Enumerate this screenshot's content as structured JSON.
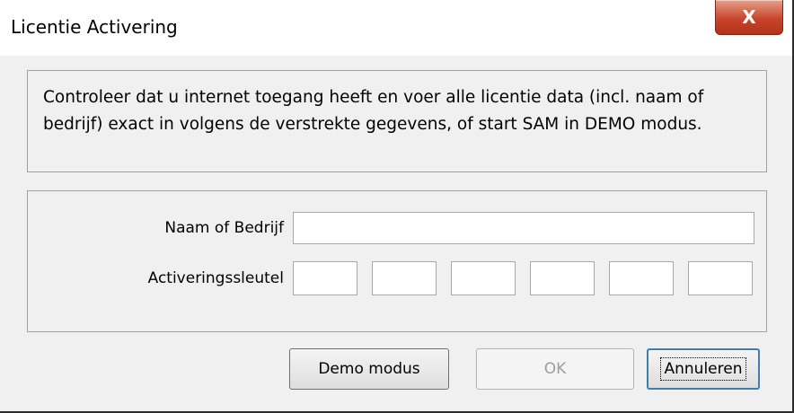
{
  "window": {
    "title": "Licentie Activering",
    "close_label": "X"
  },
  "info": {
    "line1": "Controleer dat u internet toegang heeft en voer alle licentie data (incl. naam of",
    "line2": "bedrijf) exact in volgens de verstrekte gegevens, of start SAM in DEMO modus."
  },
  "form": {
    "name_label": "Naam of Bedrijf",
    "name_value": "",
    "key_label": "Activeringssleutel",
    "key_segments": [
      "",
      "",
      "",
      "",
      "",
      ""
    ]
  },
  "buttons": {
    "demo": "Demo modus",
    "ok": "OK",
    "cancel": "Annuleren"
  }
}
